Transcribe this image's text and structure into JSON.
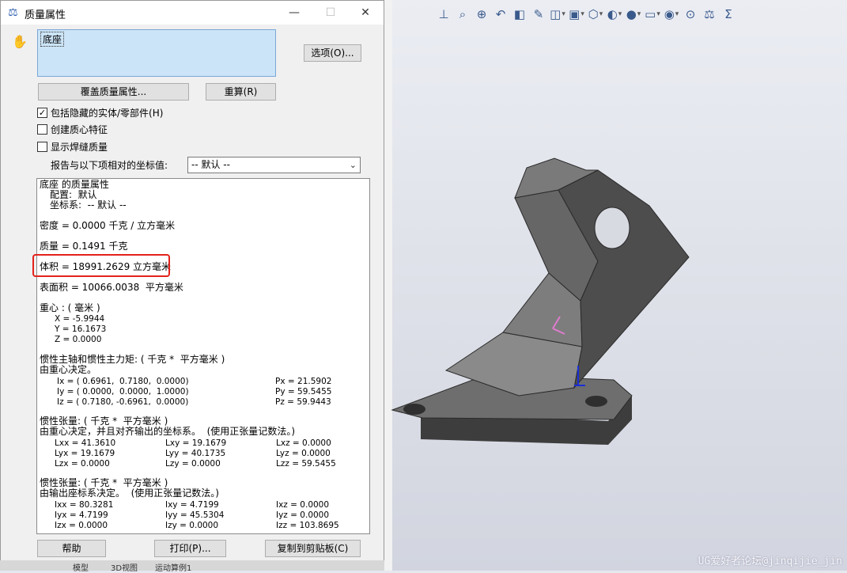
{
  "dialog": {
    "title": "质量属性",
    "selected_item": "底座",
    "options_button": "选项(O)...",
    "override_button": "覆盖质量属性...",
    "recalc_button": "重算(R)",
    "checkbox_hidden": {
      "label": "包括隐藏的实体/零部件(H)",
      "checked": true
    },
    "checkbox_com": {
      "label": "创建质心特征",
      "checked": false
    },
    "checkbox_weld": {
      "label": "显示焊缝质量",
      "checked": false
    },
    "coord_label": "报告与以下项相对的坐标值:",
    "coord_value": "-- 默认 --",
    "help_button": "帮助",
    "print_button": "打印(P)...",
    "copy_button": "复制到剪贴板(C)"
  },
  "report": {
    "header": "底座 的质量属性",
    "config": "配置:  默认",
    "coord_sys": "坐标系:  -- 默认 --",
    "density": "密度 = 0.0000 千克 / 立方毫米",
    "mass": "质量 = 0.1491 千克",
    "volume": "体积 = 18991.2629 立方毫米",
    "surface": "表面积 = 10066.0038  平方毫米",
    "cog_title": "重心 : ( 毫米 )",
    "cog_x": "X = -5.9944",
    "cog_y": "Y = 16.1673",
    "cog_z": "Z = 0.0000",
    "principal_title": "惯性主轴和惯性主力矩: ( 千克 *  平方毫米 )",
    "principal_sub": "由重心决定。",
    "ix": "Ix = ( 0.6961,  0.7180,  0.0000)",
    "iy": "Iy = ( 0.0000,  0.0000,  1.0000)",
    "iz": "Iz = ( 0.7180, -0.6961,  0.0000)",
    "px": "Px = 21.5902",
    "py": "Py = 59.5455",
    "pz": "Pz = 59.9443",
    "tensor1_title": "惯性张量: ( 千克 *  平方毫米 )",
    "tensor1_sub": "由重心决定，并且对齐输出的坐标系。  (使用正张量记数法。)",
    "lxx": "Lxx = 41.3610",
    "lxy": "Lxy = 19.1679",
    "lxz": "Lxz = 0.0000",
    "lyx": "Lyx = 19.1679",
    "lyy": "Lyy = 40.1735",
    "lyz": "Lyz = 0.0000",
    "lzx": "Lzx = 0.0000",
    "lzy": "Lzy = 0.0000",
    "lzz": "Lzz = 59.5455",
    "tensor2_title": "惯性张量: ( 千克 *  平方毫米 )",
    "tensor2_sub": "由输出座标系决定。  (使用正张量记数法。)",
    "ixx": "Ixx = 80.3281",
    "ixy": "Ixy = 4.7199",
    "ixz": "Ixz = 0.0000",
    "iyx": "Iyx = 4.7199",
    "iyy": "Iyy = 45.5304",
    "iyz": "Iyz = 0.0000",
    "izx": "Izx = 0.0000",
    "izy": "Izy = 0.0000",
    "izz": "Izz = 103.8695"
  },
  "toolbar_icons": [
    "view-orient-icon",
    "zoom-fit-icon",
    "zoom-area-icon",
    "previous-view-icon",
    "section-view-icon",
    "dynamic-annotation-icon",
    "view-orientation-icon",
    "display-style-icon",
    "hide-show-icon",
    "edit-appearance-icon",
    "apply-scene-icon",
    "view-settings-icon",
    "display-pane-icon",
    "realview-icon",
    "mass-properties-icon",
    "sum-icon"
  ],
  "watermark": "UG爱好者论坛@jinqijie_jin",
  "bottom_tabs": [
    "模型",
    "3D视图",
    "运动算例1"
  ],
  "colors": {
    "accent_red": "#e3221c",
    "list_selected": "#cce4f7",
    "model_gray": "#5b5b5b"
  }
}
